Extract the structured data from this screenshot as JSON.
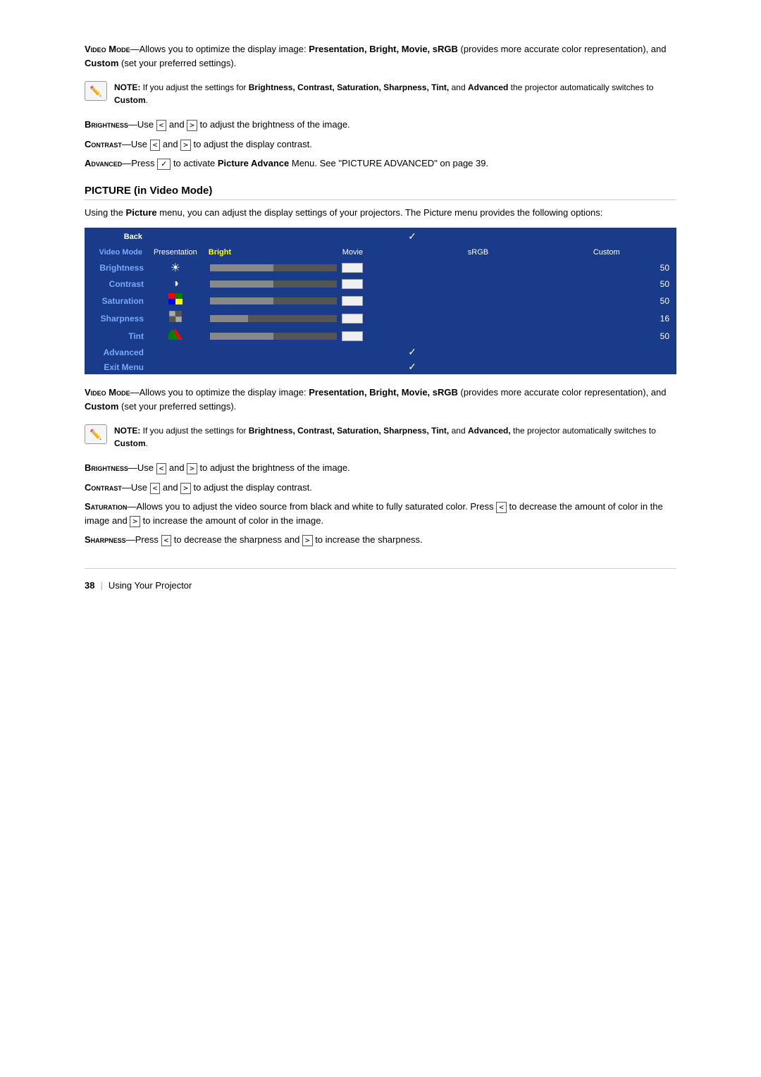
{
  "page": {
    "number": "38",
    "label": "Using Your Projector"
  },
  "section1": {
    "video_mode_text": "—Allows you to optimize the display image: ",
    "video_mode_values": "Presentation, Bright, Movie, sRGB",
    "video_mode_values2": " (provides more accurate color representation), and ",
    "video_mode_custom": "Custom",
    "video_mode_end": " (set your preferred settings).",
    "video_mode_label": "Video Mode",
    "note_label": "NOTE:",
    "note_text": " If you adjust the settings for ",
    "note_bold": "Brightness, Contrast, Saturation, Sharpness, Tint,",
    "note_text2": " and ",
    "note_bold2": "Advanced",
    "note_text3": " the projector automatically switches to ",
    "note_custom": "Custom",
    "note_end": ".",
    "brightness_label": "Brightness",
    "brightness_text": "—Use",
    "brightness_text2": "and",
    "brightness_text3": "to adjust the brightness of the image.",
    "contrast_label": "Contrast",
    "contrast_text": "—Use",
    "contrast_text2": "and",
    "contrast_text3": "to adjust the display contrast.",
    "advanced_label": "Advanced",
    "advanced_text": "—Press",
    "advanced_text2": "to activate",
    "advanced_bold": "Picture Advance",
    "advanced_text3": "Menu. See \"PICTURE ADVANCED\" on page 39."
  },
  "section2": {
    "title": "PICTURE (in Video Mode)",
    "intro": "Using the ",
    "intro_bold": "Picture",
    "intro_text": " menu, you can adjust the display settings of your projectors. The Picture menu provides the following options:"
  },
  "menu": {
    "back_label": "Back",
    "video_mode_label": "Video Mode",
    "columns": [
      "Presentation",
      "Bright",
      "Movie",
      "sRGB",
      "Custom"
    ],
    "rows": [
      {
        "label": "Brightness",
        "icon": "☀",
        "value": "50",
        "fill": 50
      },
      {
        "label": "Contrast",
        "icon": "◑",
        "value": "50",
        "fill": 50
      },
      {
        "label": "Saturation",
        "icon": "🎨",
        "value": "50",
        "fill": 50
      },
      {
        "label": "Sharpness",
        "icon": "▦",
        "value": "16",
        "fill": 30
      },
      {
        "label": "Tint",
        "icon": "🎨",
        "value": "50",
        "fill": 50
      },
      {
        "label": "Advanced",
        "icon": "",
        "value": "",
        "fill": 0
      },
      {
        "label": "Exit Menu",
        "icon": "",
        "value": "",
        "fill": 0
      }
    ]
  },
  "section3": {
    "video_mode_text": "—Allows you to optimize the display image: ",
    "video_mode_bold": "Presentation, Bright, Movie, sRGB",
    "video_mode_text2": " (provides more accurate color representation), and ",
    "video_mode_custom": "Custom",
    "video_mode_end": " (set your preferred settings).",
    "note_label": "NOTE:",
    "note_text": " If you adjust the settings for ",
    "note_bold": "Brightness, Contrast, Saturation, Sharpness, Tint,",
    "note_text2": " and ",
    "note_bold2": "Advanced,",
    "note_text3": " the projector automatically switches to",
    "note_custom": "Custom",
    "note_end": ".",
    "brightness_label": "Brightness",
    "brightness_text": "—Use",
    "brightness_text2": "and",
    "brightness_text3": "to adjust the brightness of the image.",
    "contrast_label": "Contrast",
    "contrast_text": "—Use",
    "contrast_text2": "and",
    "contrast_text3": "to adjust the display contrast.",
    "saturation_label": "Saturation",
    "saturation_text": "—Allows you to adjust the video source from black and white to fully saturated color. Press",
    "saturation_text2": "to decrease the amount of color in the image and",
    "saturation_text3": "to increase the amount of color in the image.",
    "sharpness_label": "Sharpness",
    "sharpness_text": "—Press",
    "sharpness_text2": "to decrease the sharpness and",
    "sharpness_text3": "to increase the sharpness."
  },
  "arrows": {
    "left": "<",
    "right": ">"
  }
}
